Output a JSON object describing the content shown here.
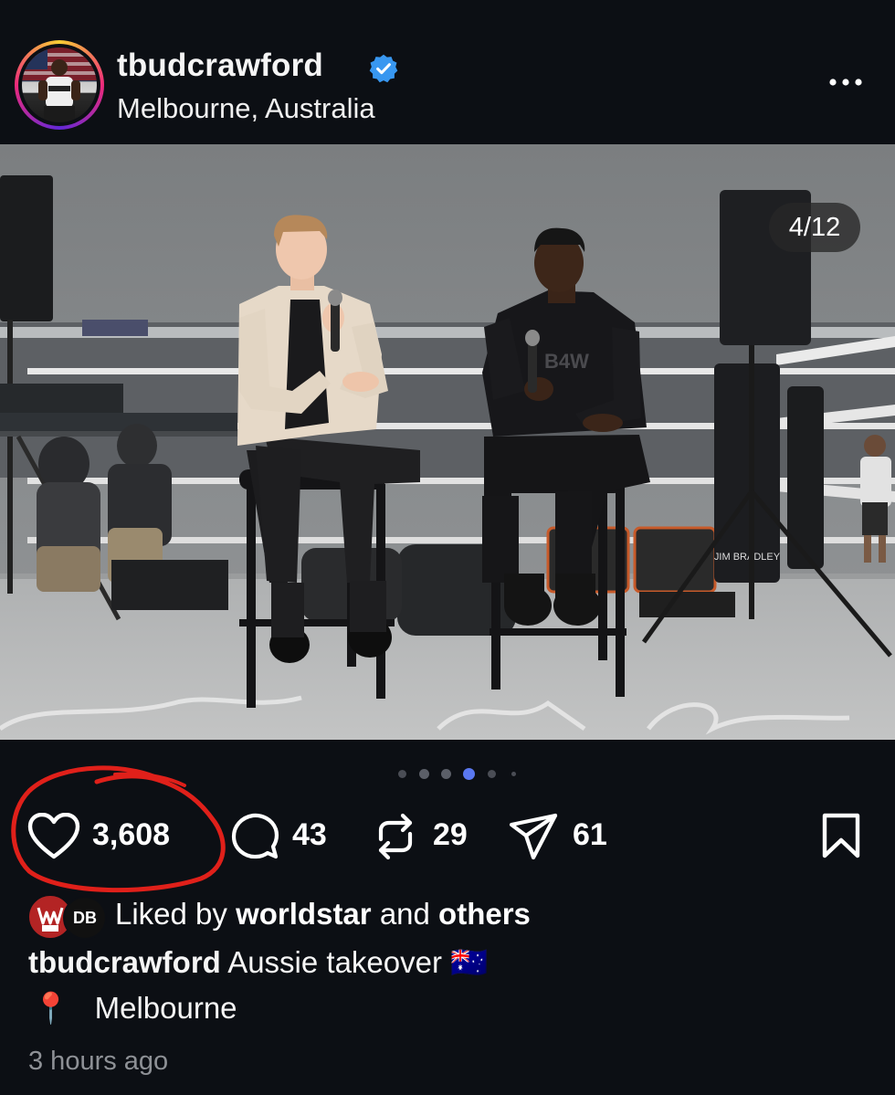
{
  "post": {
    "username": "tbudcrawford",
    "location": "Melbourne, Australia",
    "image_counter": "4/12",
    "carousel": {
      "total_dots": 6,
      "active_index": 3
    }
  },
  "actions": {
    "likes": "3,608",
    "comments": "43",
    "reposts": "29",
    "shares": "61"
  },
  "liked_by": {
    "prefix": "Liked by",
    "user": "worldstar",
    "conj": "and",
    "others": "others",
    "avatar2_text": "DB"
  },
  "caption": {
    "username": "tbudcrawford",
    "text": "Aussie takeover",
    "flag": "🇦🇺"
  },
  "location_line": {
    "pin": "📍",
    "text": "Melbourne"
  },
  "timestamp": "3 hours ago",
  "colors": {
    "background": "#0c0f14",
    "verified": "#3897f0",
    "active_dot": "#5a78f0",
    "annotation": "#e0201a",
    "muted_text": "#8e9196"
  },
  "icons": [
    "verified-badge-icon",
    "more-options-icon",
    "heart-icon",
    "comment-icon",
    "repost-icon",
    "share-icon",
    "bookmark-icon",
    "location-pin-icon"
  ]
}
